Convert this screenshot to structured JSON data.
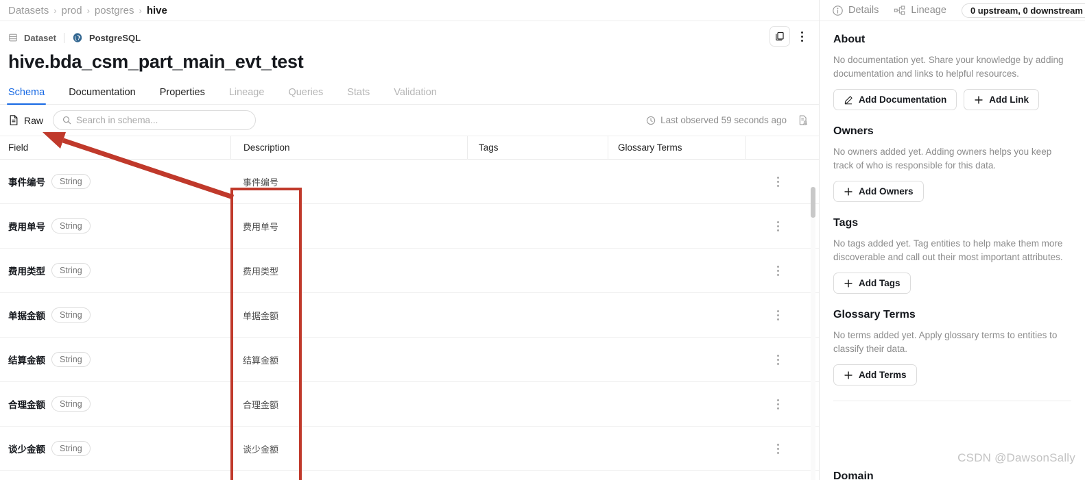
{
  "breadcrumb": {
    "items": [
      {
        "label": "Datasets",
        "current": false
      },
      {
        "label": "prod",
        "current": false
      },
      {
        "label": "postgres",
        "current": false
      },
      {
        "label": "hive",
        "current": true
      }
    ],
    "separator": "›"
  },
  "entity": {
    "type_label": "Dataset",
    "platform_label": "PostgreSQL",
    "title": "hive.bda_csm_part_main_evt_test",
    "type_icon": "table-icon",
    "platform_icon": "postgresql-icon",
    "copy_icon": "copy-icon",
    "more_icon": "kebab-menu-icon"
  },
  "tabs": [
    {
      "label": "Schema",
      "state": "active"
    },
    {
      "label": "Documentation",
      "state": "enabled"
    },
    {
      "label": "Properties",
      "state": "enabled"
    },
    {
      "label": "Lineage",
      "state": "disabled"
    },
    {
      "label": "Queries",
      "state": "disabled"
    },
    {
      "label": "Stats",
      "state": "disabled"
    },
    {
      "label": "Validation",
      "state": "disabled"
    }
  ],
  "toolbar": {
    "raw_label": "Raw",
    "raw_icon": "file-document-icon",
    "search_value": "",
    "search_placeholder": "Search in schema...",
    "search_icon": "search-icon",
    "observed_text": "Last observed 59 seconds ago",
    "observed_icon": "clock-icon",
    "schema_blame_icon": "document-user-icon"
  },
  "schema_table": {
    "columns": [
      "Field",
      "Description",
      "Tags",
      "Glossary Terms"
    ],
    "rows": [
      {
        "field": "事件编号",
        "type": "String",
        "description": "事件编号",
        "tags": "",
        "glossary": ""
      },
      {
        "field": "费用单号",
        "type": "String",
        "description": "费用单号",
        "tags": "",
        "glossary": ""
      },
      {
        "field": "费用类型",
        "type": "String",
        "description": "费用类型",
        "tags": "",
        "glossary": ""
      },
      {
        "field": "单据金额",
        "type": "String",
        "description": "单据金额",
        "tags": "",
        "glossary": ""
      },
      {
        "field": "结算金额",
        "type": "String",
        "description": "结算金额",
        "tags": "",
        "glossary": ""
      },
      {
        "field": "合理金额",
        "type": "String",
        "description": "合理金额",
        "tags": "",
        "glossary": ""
      },
      {
        "field": "谈少金额",
        "type": "String",
        "description": "谈少金额",
        "tags": "",
        "glossary": ""
      }
    ]
  },
  "sidebar": {
    "tabs": [
      {
        "label": "Details",
        "icon": "info-circle-icon"
      },
      {
        "label": "Lineage",
        "icon": "lineage-graph-icon"
      }
    ],
    "lineage_count": "0 upstream, 0 downstream",
    "sections": [
      {
        "title": "About",
        "text": "No documentation yet. Share your knowledge by adding documentation and links to helpful resources.",
        "buttons": [
          {
            "label": "Add Documentation",
            "icon": "pencil-icon"
          },
          {
            "label": "Add Link",
            "icon": "plus-icon"
          }
        ]
      },
      {
        "title": "Owners",
        "text": "No owners added yet. Adding owners helps you keep track of who is responsible for this data.",
        "buttons": [
          {
            "label": "Add Owners",
            "icon": "plus-icon"
          }
        ]
      },
      {
        "title": "Tags",
        "text": "No tags added yet. Tag entities to help make them more discoverable and call out their most important attributes.",
        "buttons": [
          {
            "label": "Add Tags",
            "icon": "plus-icon"
          }
        ]
      },
      {
        "title": "Glossary Terms",
        "text": "No terms added yet. Apply glossary terms to entities to classify their data.",
        "buttons": [
          {
            "label": "Add Terms",
            "icon": "plus-icon"
          }
        ]
      }
    ],
    "next_section_title": "Domain",
    "watermark": "CSDN @DawsonSally"
  },
  "annotation": {
    "color": "#c0392b",
    "box_target": "description-column",
    "arrow_from": "description-column",
    "arrow_to": "raw-button"
  },
  "colors": {
    "accent_blue": "#1668e3",
    "annotation_red": "#c0392b",
    "muted_text": "#8c8c8c"
  }
}
